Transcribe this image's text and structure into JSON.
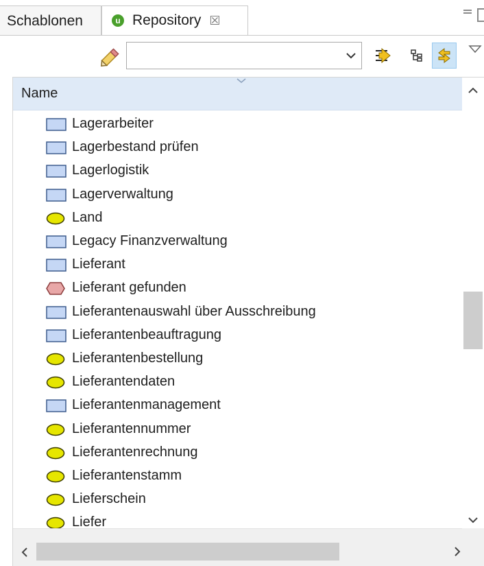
{
  "tabs": [
    {
      "label": "Schablonen",
      "active": false
    },
    {
      "label": "Repository",
      "active": true,
      "icon": "repository-icon",
      "close_glyph": "☒"
    }
  ],
  "window_controls": {
    "minimize": "minimize-icon",
    "maximize": "maximize-icon"
  },
  "toolbar": {
    "filter_icon": "pencil-filter-icon",
    "filter_value": "",
    "buttons": [
      "link-editor-icon",
      "tree-layout-icon",
      "sync-icon"
    ],
    "view_menu_icon": "chevron-down-icon"
  },
  "tree": {
    "column_header": "Name",
    "rows": [
      {
        "label": "Lagerarbeiter",
        "icon": "rectangle-icon"
      },
      {
        "label": "Lagerbestand prüfen",
        "icon": "rectangle-icon"
      },
      {
        "label": "Lagerlogistik",
        "icon": "rectangle-icon"
      },
      {
        "label": "Lagerverwaltung",
        "icon": "rectangle-icon"
      },
      {
        "label": "Land",
        "icon": "ellipse-icon"
      },
      {
        "label": "Legacy Finanzverwaltung",
        "icon": "rectangle-icon"
      },
      {
        "label": "Lieferant",
        "icon": "rectangle-icon"
      },
      {
        "label": "Lieferant gefunden",
        "icon": "hexagon-icon"
      },
      {
        "label": "Lieferantenauswahl über Ausschreibung",
        "icon": "rectangle-icon"
      },
      {
        "label": "Lieferantenbeauftragung",
        "icon": "rectangle-icon"
      },
      {
        "label": "Lieferantenbestellung",
        "icon": "ellipse-icon"
      },
      {
        "label": "Lieferantendaten",
        "icon": "ellipse-icon"
      },
      {
        "label": "Lieferantenmanagement",
        "icon": "rectangle-icon"
      },
      {
        "label": "Lieferantennummer",
        "icon": "ellipse-icon"
      },
      {
        "label": "Lieferantenrechnung",
        "icon": "ellipse-icon"
      },
      {
        "label": "Lieferantenstamm",
        "icon": "ellipse-icon"
      },
      {
        "label": "Lieferschein",
        "icon": "ellipse-icon"
      },
      {
        "label": "Liefer",
        "icon": "ellipse-icon"
      }
    ]
  },
  "colors": {
    "rectangle_fill": "#c5d7f5",
    "rectangle_stroke": "#3b5a8c",
    "ellipse_fill": "#e6e600",
    "ellipse_stroke": "#3a3a00",
    "hexagon_fill": "#e8a7a7",
    "hexagon_stroke": "#8a3a3a",
    "header_bg": "#dfeaf7"
  }
}
